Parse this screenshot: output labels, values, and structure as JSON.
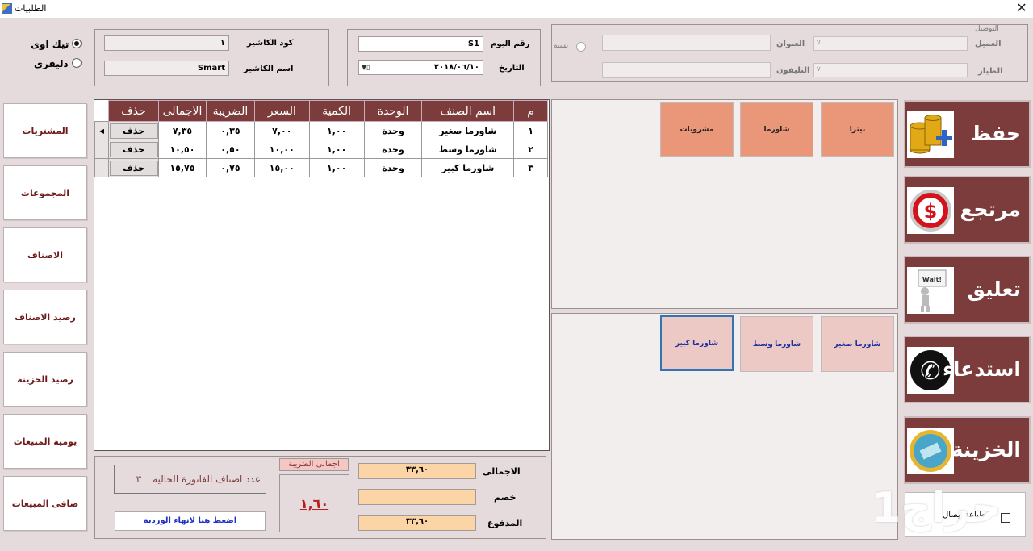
{
  "window": {
    "title": "الطلبيات",
    "close": "✕"
  },
  "order_type": {
    "options": [
      {
        "label": "تيك اوى",
        "selected": true
      },
      {
        "label": "دليفرى",
        "selected": false
      }
    ]
  },
  "cashier": {
    "code_label": "كود الكاشير",
    "code_value": "١",
    "name_label": "اسم الكاشير",
    "name_value": "Smart"
  },
  "day": {
    "day_no_label": "رقم اليوم",
    "day_no_value": "S1",
    "date_label": "التاريخ",
    "date_value": "٢٠١٨/٠٦/١٠"
  },
  "delivery": {
    "group_label": "التوصيل",
    "customer_label": "العميل",
    "address_label": "العنوان",
    "pilot_label": "الطيار",
    "phone_label": "التليفون",
    "credit_label": "نسية"
  },
  "nav": {
    "purchases": "المشتريات",
    "groups": "المجموعات",
    "items": "الاصناف",
    "item_balance": "رصيد الاصناف",
    "treasury_balance": "رصيد الخزينة",
    "daily_sales": "يومية المبيعات",
    "net_sales": "صافى المبيعات"
  },
  "grid": {
    "headers": [
      "م",
      "اسم الصنف",
      "الوحدة",
      "الكمية",
      "السعر",
      "الضريبة",
      "الاجمالى",
      "حذف"
    ],
    "rows": [
      {
        "no": "١",
        "name": "شاورما صغير",
        "unit": "وحدة",
        "qty": "١,٠٠",
        "price": "٧,٠٠",
        "tax": "٠,٣٥",
        "total": "٧,٣٥",
        "del": "حذف"
      },
      {
        "no": "٢",
        "name": "شاورما وسط",
        "unit": "وحدة",
        "qty": "١,٠٠",
        "price": "١٠,٠٠",
        "tax": "٠,٥٠",
        "total": "١٠,٥٠",
        "del": "حذف"
      },
      {
        "no": "٣",
        "name": "شاورما كبير",
        "unit": "وحدة",
        "qty": "١,٠٠",
        "price": "١٥,٠٠",
        "tax": "٠,٧٥",
        "total": "١٥,٧٥",
        "del": "حذف"
      }
    ]
  },
  "categories": [
    "بيتزا",
    "شاورما",
    "مشروبات"
  ],
  "products": [
    "شاورما صغير",
    "شاورما وسط",
    "شاورما كبير"
  ],
  "summary": {
    "count_label": "عدد اصناف الفاتورة الحالية",
    "count_value": "٣",
    "finish_link": "اضغط هنا لانهاء الوردية",
    "tax_total_label": "اجمالى الضريبة",
    "tax_total_value": "١,٦٠",
    "total_label": "الاجمالى",
    "total_value": "٣٣,٦٠",
    "discount_label": "خصم",
    "discount_value": "",
    "paid_label": "المدفوع",
    "paid_value": "٣٣,٦٠"
  },
  "actions": {
    "save": "حفظ",
    "return": "مرتجع",
    "hold": "تعليق",
    "recall": "استدعاء",
    "treasury": "الخزينة",
    "print_receipt": "طباعة إيصال"
  },
  "watermark": "حراج1",
  "icons": {
    "wait_sign": "Wait!"
  }
}
